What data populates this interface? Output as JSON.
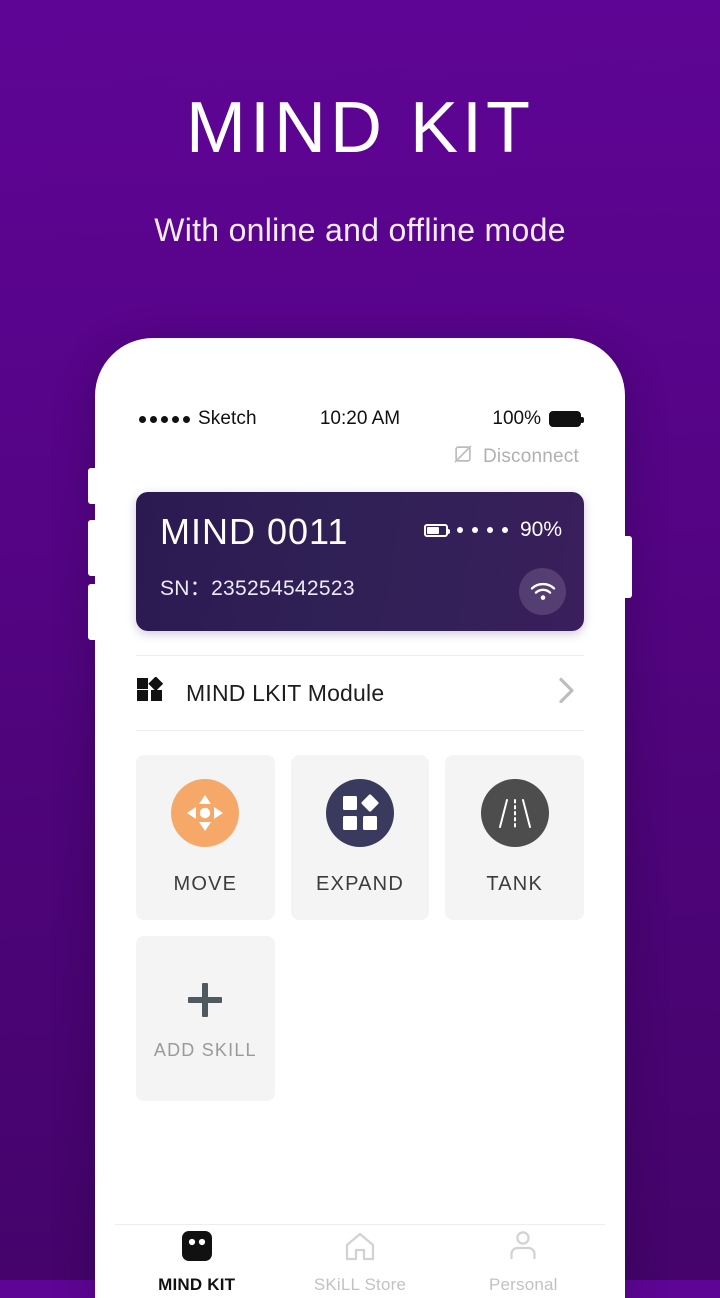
{
  "promo": {
    "title": "MIND KIT",
    "subtitle": "With online and offline mode"
  },
  "colors": {
    "background_top": "#5f0596",
    "background_bottom": "#44046b",
    "card_gradient_start": "#2b1a52",
    "card_gradient_end": "#3a1f5c",
    "move_icon": "#f5a867",
    "expand_icon": "#3a3a5e",
    "tank_icon": "#4d4d4d",
    "tile_background": "#f4f4f4"
  },
  "statusbar": {
    "carrier": "Sketch",
    "signal_dots": 5,
    "time": "10:20 AM",
    "battery_percent": "100%"
  },
  "topbar": {
    "disconnect_label": "Disconnect",
    "disconnect_icon": "no-connection-icon"
  },
  "device": {
    "name": "MIND 0011",
    "sn_label": "SN：",
    "sn_value": "235254542523",
    "battery_percent": "90%",
    "battery_dots": 4,
    "wifi_icon": "wifi-icon"
  },
  "module": {
    "label": "MIND LKIT Module",
    "icon": "modules-grid-icon",
    "chevron": "chevron-right-icon"
  },
  "skills": [
    {
      "label": "MOVE",
      "icon": "move-dpad-icon"
    },
    {
      "label": "EXPAND",
      "icon": "expand-blocks-icon"
    },
    {
      "label": "TANK",
      "icon": "tank-road-icon"
    }
  ],
  "add_skill": {
    "label": "ADD SKILL",
    "icon": "plus-icon"
  },
  "tabs": [
    {
      "label": "MIND KIT",
      "icon": "robot-head-icon",
      "active": true
    },
    {
      "label": "SKiLL Store",
      "icon": "home-icon",
      "active": false
    },
    {
      "label": "Personal",
      "icon": "person-icon",
      "active": false
    }
  ]
}
